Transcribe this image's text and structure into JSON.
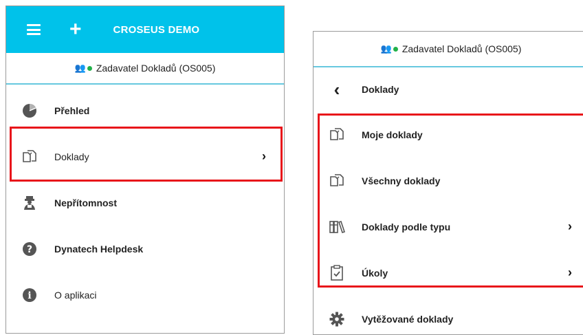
{
  "left": {
    "topbar": {
      "title": "CROSEUS DEMO"
    },
    "user": {
      "name": "Zadavatel Dokladů (OS005)",
      "status_color": "#21b14a"
    },
    "menu": [
      {
        "label": "Přehled",
        "icon": "pie-chart-icon"
      },
      {
        "label": "Doklady",
        "icon": "documents-icon",
        "has_submenu": true,
        "highlighted": true
      },
      {
        "label": "Nepřítomnost",
        "icon": "absence-icon"
      },
      {
        "label": "Dynatech Helpdesk",
        "icon": "question-icon"
      },
      {
        "label": "O aplikaci",
        "icon": "info-icon"
      }
    ]
  },
  "right": {
    "user": {
      "name": "Zadavatel Dokladů (OS005)",
      "status_color": "#21b14a"
    },
    "back_label": "Doklady",
    "menu": [
      {
        "label": "Moje doklady",
        "icon": "documents-icon",
        "highlighted": true
      },
      {
        "label": "Všechny doklady",
        "icon": "documents-icon",
        "highlighted": true
      },
      {
        "label": "Doklady podle typu",
        "icon": "binders-icon",
        "has_submenu": true,
        "highlighted": true
      },
      {
        "label": "Úkoly",
        "icon": "clipboard-check-icon",
        "has_submenu": true,
        "highlighted": true
      },
      {
        "label": "Vytěžované doklady",
        "icon": "gear-icon"
      }
    ]
  },
  "colors": {
    "topbar": "#00c2ea",
    "highlight": "#e8141a",
    "divider": "#66c8df"
  }
}
